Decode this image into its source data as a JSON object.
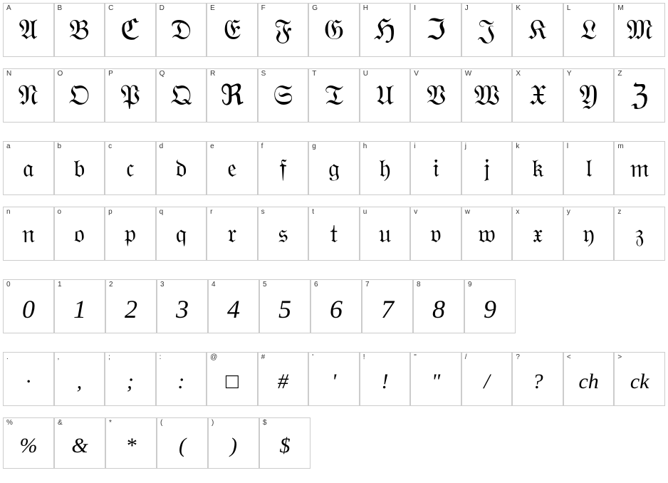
{
  "uppercase": {
    "labels": [
      "A",
      "B",
      "C",
      "D",
      "E",
      "F",
      "G",
      "H",
      "I",
      "J",
      "K",
      "L",
      "M"
    ],
    "glyphs": [
      "𝔄",
      "𝔅",
      "ℭ",
      "𝔇",
      "𝔈",
      "𝔉",
      "𝔊",
      "ℌ",
      "ℑ",
      "𝔍",
      "𝔎",
      "𝔏",
      "𝔐"
    ]
  },
  "uppercase2": {
    "labels": [
      "N",
      "O",
      "P",
      "Q",
      "R",
      "S",
      "T",
      "U",
      "V",
      "W",
      "X",
      "Y",
      "Z"
    ],
    "glyphs": [
      "𝔑",
      "𝔒",
      "𝔓",
      "𝔔",
      "ℜ",
      "𝔖",
      "𝔗",
      "𝔘",
      "𝔙",
      "𝔚",
      "𝔛",
      "𝔜",
      "ℨ"
    ]
  },
  "lowercase": {
    "labels": [
      "a",
      "b",
      "c",
      "d",
      "e",
      "f",
      "g",
      "h",
      "i",
      "j",
      "k",
      "l",
      "m"
    ],
    "glyphs": [
      "𝔞",
      "𝔟",
      "𝔠",
      "𝔡",
      "𝔢",
      "𝔣",
      "𝔤",
      "𝔥",
      "𝔦",
      "𝔧",
      "𝔨",
      "𝔩",
      "𝔪"
    ]
  },
  "lowercase2": {
    "labels": [
      "n",
      "o",
      "p",
      "q",
      "r",
      "s",
      "t",
      "u",
      "v",
      "w",
      "x",
      "y",
      "z"
    ],
    "glyphs": [
      "𝔫",
      "𝔬",
      "𝔭",
      "𝔮",
      "𝔯",
      "𝔰",
      "𝔱",
      "𝔲",
      "𝔳",
      "𝔴",
      "𝔵",
      "𝔶",
      "𝔷"
    ]
  },
  "numbers": {
    "labels": [
      "0",
      "1",
      "2",
      "3",
      "4",
      "5",
      "6",
      "7",
      "8",
      "9"
    ],
    "glyphs": [
      "0",
      "1",
      "2",
      "3",
      "4",
      "5",
      "6",
      "7",
      "8",
      "9"
    ]
  },
  "symbols1": {
    "labels": [
      ".",
      ",",
      ";",
      ":",
      "@",
      "#",
      "'",
      "!",
      "\"",
      "/",
      "?",
      "<",
      ">"
    ],
    "glyphs": [
      "·",
      "‚",
      ";",
      ":",
      "□",
      "#",
      "'",
      "!",
      "\"",
      "/",
      "?",
      "ch",
      "ck"
    ]
  },
  "symbols2": {
    "labels": [
      "%",
      "&",
      "*",
      "(",
      ")",
      "$"
    ],
    "glyphs": [
      "%",
      "&",
      "*",
      "(",
      ")",
      "$"
    ]
  }
}
